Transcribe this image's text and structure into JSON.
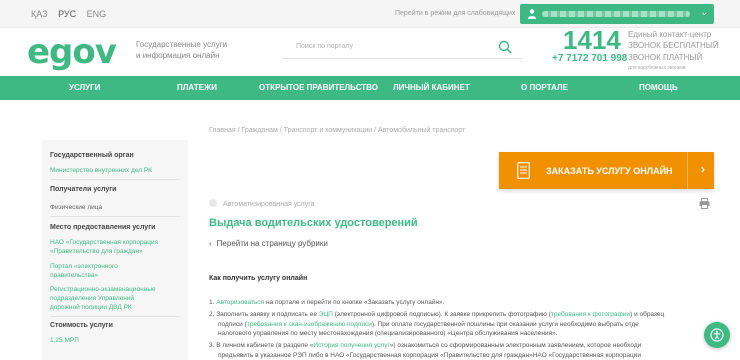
{
  "topbar": {
    "languages": [
      "ҚАЗ",
      "РУС",
      "ENG"
    ],
    "impaired_label": "Перейти в режим для слабовидящих"
  },
  "header": {
    "logo": "egov",
    "logo_subtitle_1": "Государственные услуги",
    "logo_subtitle_2": "и информация онлайн",
    "search_placeholder": "Поиск по порталу",
    "contact_number": "1414",
    "contact_label_1": "Единый контакт-центр",
    "contact_label_2": "ЗВОНОК БЕСПЛАТНЫЙ",
    "paid_phone": "+7 7172 701 998",
    "paid_label": "ЗВОНОК ПЛАТНЫЙ",
    "paid_sublabel": "для зарубежных звонков"
  },
  "nav": {
    "items": [
      "УСЛУГИ",
      "ПЛАТЕЖИ",
      "ОТКРЫТОЕ ПРАВИТЕЛЬСТВО",
      "ЛИЧНЫЙ КАБИНЕТ",
      "О ПОРТАЛЕ",
      "ПОМОЩЬ"
    ]
  },
  "sidebar": {
    "gov_body_heading": "Государственный орган",
    "gov_body_value": "Министерство внутренних дел РК",
    "recipients_heading": "Получатели услуги",
    "recipients_value": "Физические лица",
    "place_heading": "Место предоставления услуги",
    "place_1_line1": "НАО «Государственная корпорация",
    "place_1_line2": "«Правительство для граждан»",
    "place_2_line1": "Портал «электронного",
    "place_2_line2": "правительства»",
    "place_3_line1": "Регистрационно-экзаменационные",
    "place_3_line2": "подразделения Управлений",
    "place_3_line3": "дорожной полиции ДВД РК",
    "cost_heading": "Стоимость услуги",
    "cost_value": "1,25 МРП"
  },
  "breadcrumb": "Главная / Гражданам / Транспорт и коммуникации / Автомобильный транспорт",
  "order_button": "ЗАКАЗАТЬ УСЛУГУ ОНЛАЙН",
  "service": {
    "badge": "Автоматизированная услуга",
    "title": "Выдача водительских удостоверений",
    "back_link": "Перейти на страницу рубрики",
    "howto": "Как получить услугу онлайн"
  },
  "steps": {
    "s1_link": "Авторизоваться",
    "s1_text": " на портале и перейти по кнопке «Заказать услугу онлайн».",
    "s2_a": "Заполнить заявку и подписать ее ",
    "s2_link1": "ЭЦП",
    "s2_b": " (электронной цифровой подписью). К заявке прикрепить фотографию (",
    "s2_link2": "требования к фотографии",
    "s2_c": ") и образец",
    "s2_d": "подписи (",
    "s2_link3": "требования к скан-изображению подписи",
    "s2_e": "). При оплате государственной пошлины при оказании услуги необходимо выбрать отде",
    "s2_f": "налогового управления по месту местонахождения (специализированного) «Центра обслуживания населения».",
    "s3_a": "В личном кабинете (в разделе «",
    "s3_link": "История получения услуг",
    "s3_b": "») ознакомиться со сформированным электронным заявлением, которое необходи",
    "s3_c": "предъявить в указанное РЭП либо в НАО «Государственная корпорация «Правительство для граждан»НАО «Государственная корпорации"
  }
}
